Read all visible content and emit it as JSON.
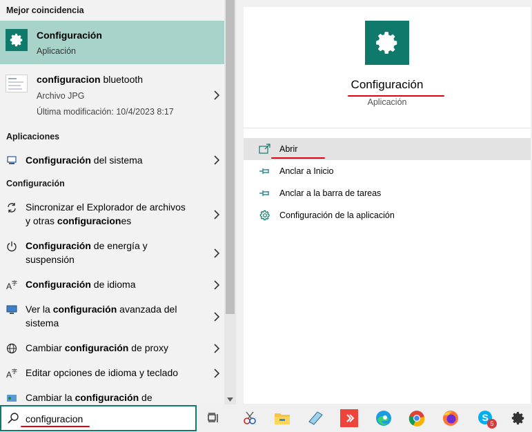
{
  "left": {
    "best_match_header": "Mejor coincidencia",
    "best_match": {
      "title": "Configuración",
      "subtitle": "Aplicación"
    },
    "document": {
      "title_bold": "configuracion",
      "title_rest": " bluetooth",
      "type": "Archivo JPG",
      "modified": "Última modificación: 10/4/2023 8:17"
    },
    "apps_header": "Aplicaciones",
    "apps": [
      {
        "bold": "Configuración",
        "rest": " del sistema"
      }
    ],
    "settings_header": "Configuración",
    "settings": [
      {
        "line1_pre": "Sincronizar el Explorador de archivos",
        "line2_pre": "y otras ",
        "line2_bold": "configuracion",
        "line2_post": "es"
      },
      {
        "line1_bold": "Configuración",
        "line1_post": " de energía y",
        "line2_pre": "suspensión"
      },
      {
        "line1_bold": "Configuración",
        "line1_post": " de idioma"
      },
      {
        "line1_pre": "Ver la ",
        "line1_bold": "configuración",
        "line1_post": " avanzada del",
        "line2_pre": "sistema"
      },
      {
        "line1_pre": "Cambiar ",
        "line1_bold": "configuración",
        "line1_post": " de proxy"
      },
      {
        "line1_pre": "Editar opciones de idioma y teclado"
      },
      {
        "line1_pre": "Cambiar la ",
        "line1_bold": "configuración",
        "line1_post": " de"
      }
    ]
  },
  "right": {
    "app_name": "Configuración",
    "app_type": "Aplicación",
    "actions": [
      {
        "label": "Abrir",
        "icon": "open-icon"
      },
      {
        "label": "Anclar a Inicio",
        "icon": "pin-icon"
      },
      {
        "label": "Anclar a la barra de tareas",
        "icon": "pin-icon"
      },
      {
        "label": "Configuración de la aplicación",
        "icon": "gear-icon"
      }
    ]
  },
  "search": {
    "value": "configuracion"
  },
  "taskbar": {
    "icons": [
      "task-view-icon",
      "snipping-tool-icon",
      "file-explorer-icon",
      "notepad-icon",
      "anydesk-icon",
      "edge-icon",
      "chrome-icon",
      "firefox-icon",
      "skype-icon",
      "settings-icon"
    ],
    "skype_badge": "5"
  },
  "colors": {
    "accent": "#0f7a6b",
    "highlight": "#a8d3cb",
    "annotation": "#e3000f"
  }
}
